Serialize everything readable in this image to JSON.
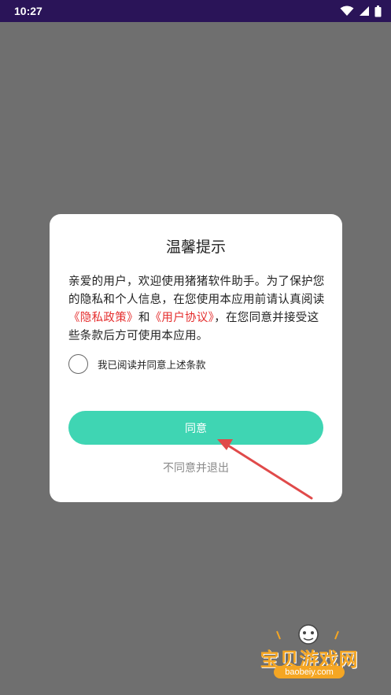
{
  "status_bar": {
    "time": "10:27",
    "icons": [
      "wifi-icon",
      "signal-icon",
      "battery-icon"
    ]
  },
  "dialog": {
    "title": "温馨提示",
    "body_part1": "亲爱的用户，欢迎使用猪猪软件助手。为了保护您的隐私和个人信息，在您使用本应用前请认真阅读",
    "privacy_link": "《隐私政策》",
    "body_and": "和",
    "user_agreement_link": "《用户协议》",
    "body_part2": "，在您同意并接受这些条款后方可使用本应用。",
    "agree_checkbox_label": "我已阅读并同意上述条款",
    "agree_button": "同意",
    "disagree_button": "不同意并退出"
  },
  "watermark": {
    "text": "宝贝游戏网",
    "url": "baobeiy.com"
  },
  "colors": {
    "status_bar": "#2a1458",
    "overlay": "#6f6f6f",
    "accent": "#3fd5b3",
    "link": "#e52e2e",
    "arrow": "#e04a4a"
  }
}
